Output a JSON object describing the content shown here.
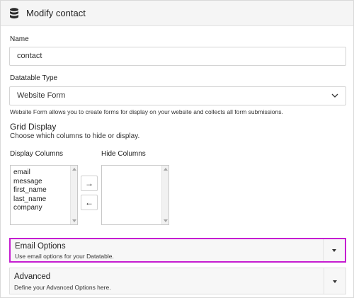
{
  "header": {
    "title": "Modify contact",
    "icon": "database-icon"
  },
  "name": {
    "label": "Name",
    "value": "contact"
  },
  "datatable_type": {
    "label": "Datatable Type",
    "selected": "Website Form",
    "help": "Website Form allows you to create forms for display on your website and collects all form submissions."
  },
  "grid_display": {
    "title": "Grid Display",
    "subtitle": "Choose which columns to hide or display.",
    "display_label": "Display Columns",
    "hide_label": "Hide Columns",
    "display_columns": [
      "email",
      "message",
      "first_name",
      "last_name",
      "company"
    ],
    "hide_columns": [],
    "move_right": "→",
    "move_left": "←"
  },
  "accordions": [
    {
      "title": "Email Options",
      "subtitle": "Use email options for your Datatable.",
      "active": true
    },
    {
      "title": "Advanced",
      "subtitle": "Define your Advanced Options here.",
      "active": false
    }
  ],
  "colors": {
    "accent_border": "#c51dd1"
  }
}
